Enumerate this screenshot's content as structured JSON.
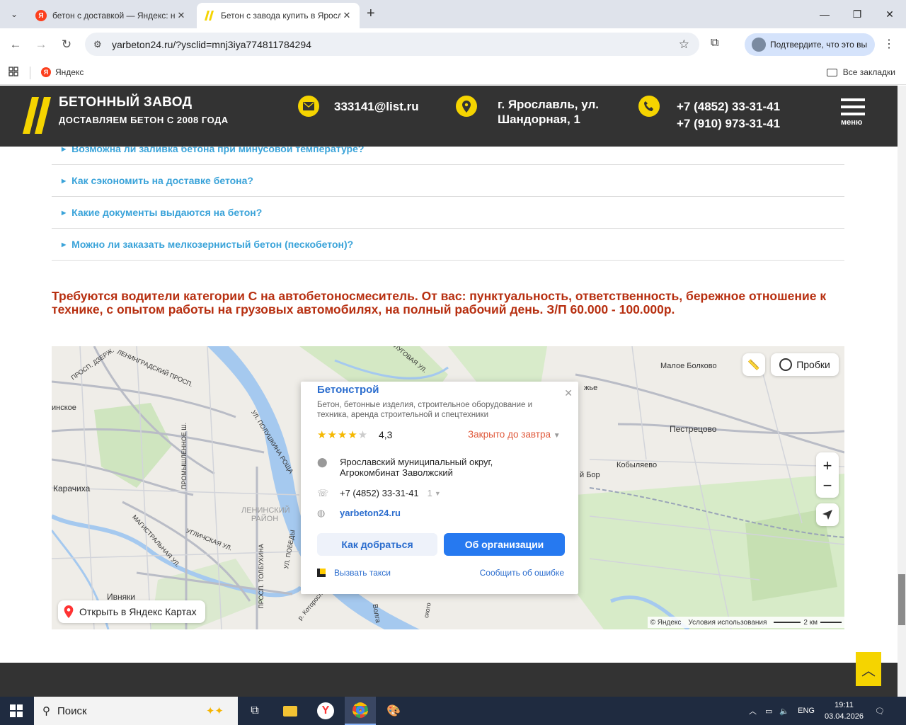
{
  "browser": {
    "tabs": [
      {
        "title": "бетон с доставкой — Яндекс: н",
        "favicon": "Я",
        "active": false
      },
      {
        "title": "Бетон с завода купить в Яросл",
        "active": true
      }
    ],
    "url": "yarbeton24.ru/?ysclid=mnj3iya774811784294",
    "profile_label": "Подтвердите, что это вы",
    "bookmarks": {
      "yandex": "Яндекс",
      "all": "Все закладки"
    }
  },
  "site": {
    "brand_title": "БЕТОННЫЙ ЗАВОД",
    "brand_subtitle": "ДОСТАВЛЯЕМ БЕТОН С 2008 ГОДА",
    "email": "333141@list.ru",
    "address_line1": "г. Ярославль, ул.",
    "address_line2": "Шандорная, 1",
    "phone1": "+7 (4852) 33-31-41",
    "phone2": "+7 (910) 973-31-41",
    "menu_label": "меню",
    "accent": "#f5d400"
  },
  "faq": [
    "Возможна ли заливка бетона при минусовой температуре?",
    "Как сэкономить на доставке бетона?",
    "Какие документы выдаются на бетон?",
    "Можно ли заказать мелкозернистый бетон (пескобетон)?"
  ],
  "notice": "Требуются водители категории С на автобетоносмеситель. От вас: пунктуальность, ответственность, бережное отношение к технике, с опытом работы на грузовых автомобилях, на полный рабочий день. З/П 60.000 - 100.000р.",
  "map": {
    "labels": {
      "leningrad": "ЛЕНИНГРАДСКИЙ ПРОСП.",
      "dzerzh": "ПРОСП. ДЗЕРЖ.",
      "inskoe": "инское",
      "karachiha": "Карачиха",
      "promyshl": "ПРОМЫШЛЕННОЕ Ш.",
      "magistral": "МАГИСТРАЛЬНАЯ УЛ.",
      "uglich": "УГЛИЧСКАЯ УЛ.",
      "leninsky": "ЛЕНИНСКИЙ РАЙОН",
      "polush": "УЛ. ПОЛУШКИНА РОЩА",
      "tolbuhin": "ПРОСП. ТОЛБУХИНА",
      "pobedy": "УЛ. ПОБЕДЫ",
      "lugovaya": "ЛУГОВАЯ УЛ.",
      "ivnyaki": "Ивняки",
      "volga": "Волга",
      "maloe": "Малое Болково",
      "pestretsovo": "Пестрецово",
      "kobylyaevo": "Кобыляево",
      "bor": "й Бор",
      "zhe": "жье",
      "kotorosl": "р. Которосль",
      "sko": "ского"
    },
    "traffic": "Пробки",
    "open_maps": "Открыть в Яндекс Картах",
    "copyright": "© Яндекс",
    "terms": "Условия использования",
    "scale": "2 км",
    "card": {
      "name": "Бетонстрой",
      "description": "Бетон, бетонные изделия, строительное оборудование и техника, аренда строительной и спецтехники",
      "rating": "4,3",
      "rating_stars": 4.3,
      "status": "Закрыто до завтра",
      "address_line1": "Ярославский муниципальный округ,",
      "address_line2": "Агрокомбинат Заволжский",
      "phone": "+7 (4852) 33-31-41",
      "phone_count": "1",
      "website": "yarbeton24.ru",
      "route_button": "Как добраться",
      "org_button": "Об организации",
      "taxi": "Вызвать такси",
      "report": "Сообщить об ошибке"
    }
  },
  "taskbar": {
    "search": "Поиск",
    "lang": "ENG",
    "time": "19:11",
    "date": "03.04.2026"
  }
}
